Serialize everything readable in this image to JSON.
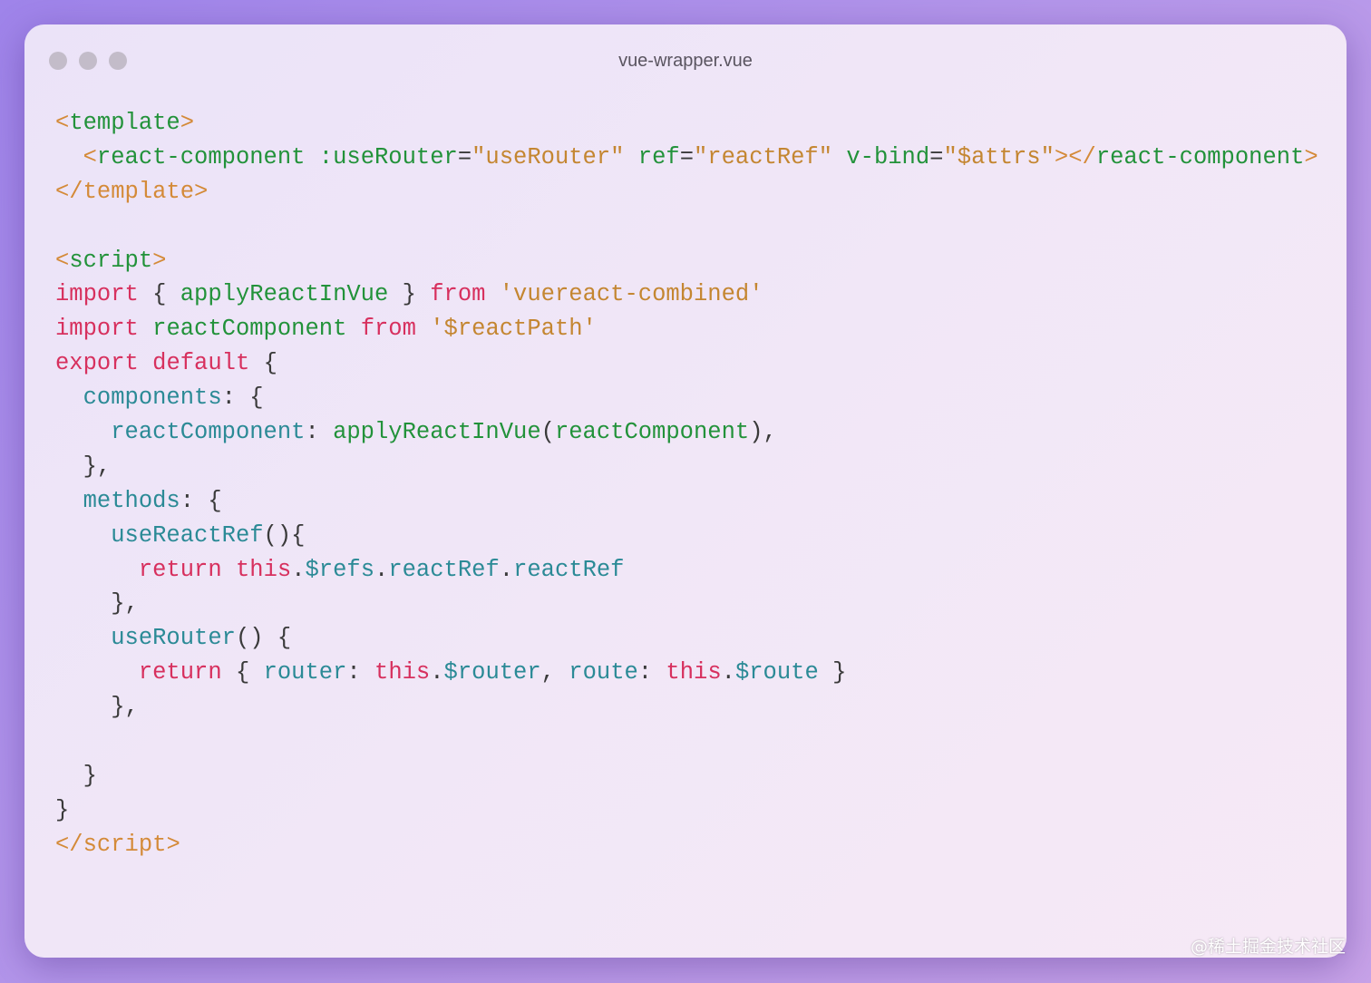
{
  "window": {
    "title": "vue-wrapper.vue",
    "buttons": [
      "close",
      "minimize",
      "maximize"
    ]
  },
  "code_lines": [
    [
      [
        "tag",
        "<"
      ],
      [
        "tagname",
        "template"
      ],
      [
        "tag",
        ">"
      ]
    ],
    [
      [
        "punct",
        "  "
      ],
      [
        "tag",
        "<"
      ],
      [
        "tagname",
        "react-component"
      ],
      [
        "punct",
        " "
      ],
      [
        "attr",
        ":useRouter"
      ],
      [
        "punct",
        "="
      ],
      [
        "string",
        "\"useRouter\""
      ],
      [
        "punct",
        " "
      ],
      [
        "attr",
        "ref"
      ],
      [
        "punct",
        "="
      ],
      [
        "string",
        "\"reactRef\""
      ],
      [
        "punct",
        " "
      ],
      [
        "attr",
        "v-bind"
      ],
      [
        "punct",
        "="
      ],
      [
        "string",
        "\"$attrs\""
      ],
      [
        "tag",
        "></"
      ],
      [
        "tagname",
        "react-component"
      ],
      [
        "tag",
        ">"
      ]
    ],
    [
      [
        "tag",
        "</"
      ],
      [
        "tag",
        "template"
      ],
      [
        "tag",
        ">"
      ]
    ],
    [],
    [
      [
        "tag",
        "<"
      ],
      [
        "tagname",
        "script"
      ],
      [
        "tag",
        ">"
      ]
    ],
    [
      [
        "keyword",
        "import"
      ],
      [
        "punct",
        " { "
      ],
      [
        "ident",
        "applyReactInVue"
      ],
      [
        "punct",
        " } "
      ],
      [
        "keyword",
        "from"
      ],
      [
        "punct",
        " "
      ],
      [
        "string",
        "'vuereact-combined'"
      ]
    ],
    [
      [
        "keyword",
        "import"
      ],
      [
        "punct",
        " "
      ],
      [
        "ident",
        "reactComponent"
      ],
      [
        "punct",
        " "
      ],
      [
        "keyword",
        "from"
      ],
      [
        "punct",
        " "
      ],
      [
        "string",
        "'$reactPath'"
      ]
    ],
    [
      [
        "keyword",
        "export"
      ],
      [
        "punct",
        " "
      ],
      [
        "keyword",
        "default"
      ],
      [
        "punct",
        " {"
      ]
    ],
    [
      [
        "punct",
        "  "
      ],
      [
        "property",
        "components"
      ],
      [
        "punct",
        ": {"
      ]
    ],
    [
      [
        "punct",
        "    "
      ],
      [
        "property",
        "reactComponent"
      ],
      [
        "punct",
        ": "
      ],
      [
        "function",
        "applyReactInVue"
      ],
      [
        "punct",
        "("
      ],
      [
        "ident",
        "reactComponent"
      ],
      [
        "punct",
        "),"
      ]
    ],
    [
      [
        "punct",
        "  },"
      ]
    ],
    [
      [
        "punct",
        "  "
      ],
      [
        "property",
        "methods"
      ],
      [
        "punct",
        ": {"
      ]
    ],
    [
      [
        "punct",
        "    "
      ],
      [
        "property",
        "useReactRef"
      ],
      [
        "punct",
        "(){"
      ]
    ],
    [
      [
        "punct",
        "      "
      ],
      [
        "keyword",
        "return"
      ],
      [
        "punct",
        " "
      ],
      [
        "keyword",
        "this"
      ],
      [
        "punct",
        "."
      ],
      [
        "property",
        "$refs"
      ],
      [
        "punct",
        "."
      ],
      [
        "property",
        "reactRef"
      ],
      [
        "punct",
        "."
      ],
      [
        "property",
        "reactRef"
      ]
    ],
    [
      [
        "punct",
        "    },"
      ]
    ],
    [
      [
        "punct",
        "    "
      ],
      [
        "property",
        "useRouter"
      ],
      [
        "punct",
        "() {"
      ]
    ],
    [
      [
        "punct",
        "      "
      ],
      [
        "keyword",
        "return"
      ],
      [
        "punct",
        " { "
      ],
      [
        "property",
        "router"
      ],
      [
        "punct",
        ": "
      ],
      [
        "keyword",
        "this"
      ],
      [
        "punct",
        "."
      ],
      [
        "property",
        "$router"
      ],
      [
        "punct",
        ", "
      ],
      [
        "property",
        "route"
      ],
      [
        "punct",
        ": "
      ],
      [
        "keyword",
        "this"
      ],
      [
        "punct",
        "."
      ],
      [
        "property",
        "$route"
      ],
      [
        "punct",
        " }"
      ]
    ],
    [
      [
        "punct",
        "    },"
      ]
    ],
    [],
    [
      [
        "punct",
        "  }"
      ]
    ],
    [
      [
        "punct",
        "}"
      ]
    ],
    [
      [
        "tag",
        "</"
      ],
      [
        "tag",
        "script"
      ],
      [
        "tag",
        ">"
      ]
    ]
  ],
  "watermark": "@稀土掘金技术社区",
  "colors": {
    "tag_bracket": "#d48a38",
    "tag_name": "#22923a",
    "string": "#c48631",
    "keyword": "#d7305e",
    "property": "#2b8a96",
    "function": "#22923a",
    "punctuation": "#3a3a3a"
  }
}
